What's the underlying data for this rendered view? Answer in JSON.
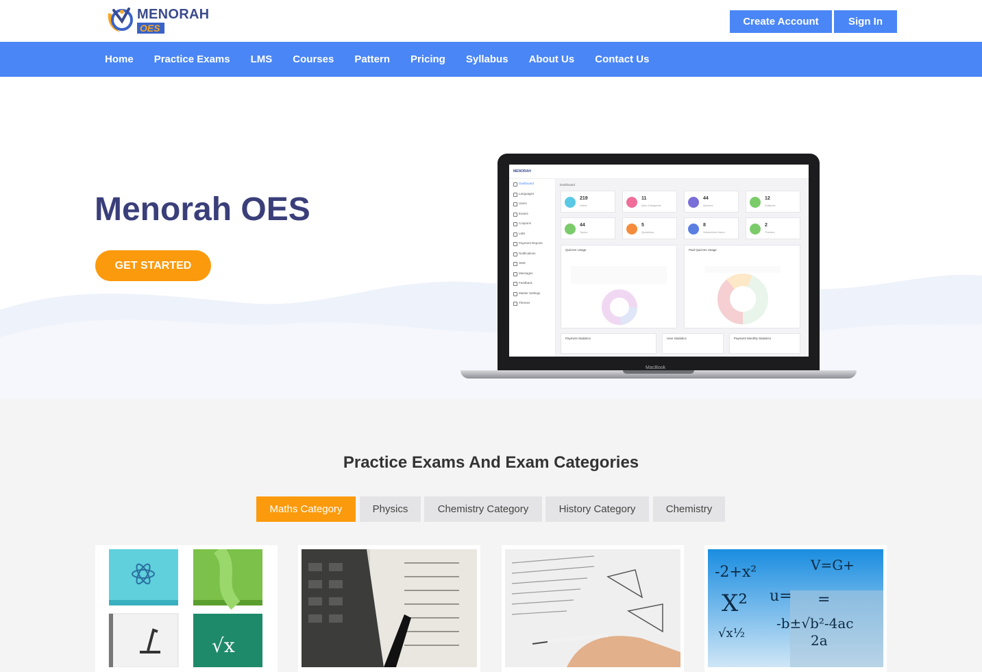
{
  "header": {
    "logo_name": "MENORAH",
    "logo_sub": "OES",
    "create_account": "Create Account",
    "sign_in": "Sign In"
  },
  "nav": {
    "items": [
      "Home",
      "Practice Exams",
      "LMS",
      "Courses",
      "Pattern",
      "Pricing",
      "Syllabus",
      "About Us",
      "Contact Us"
    ]
  },
  "hero": {
    "title": "Menorah OES",
    "cta": "GET STARTED"
  },
  "laptop_screen": {
    "brand": "MENORAH",
    "breadcrumb": "Dashboard",
    "sidebar": [
      "Dashboard",
      "Languages",
      "Users",
      "Exams",
      "Coupons",
      "LMS",
      "Payment Reports",
      "Notifications",
      "SMS",
      "Messages",
      "Feedback",
      "Master Settings",
      "Themes"
    ],
    "stats": [
      {
        "num": "219",
        "label": "Users",
        "color": "#5bc9e6"
      },
      {
        "num": "11",
        "label": "Quiz Categories",
        "color": "#f06e9a"
      },
      {
        "num": "44",
        "label": "Quizzes",
        "color": "#7a6fd8"
      },
      {
        "num": "12",
        "label": "Subjects",
        "color": "#7ccb6b"
      },
      {
        "num": "44",
        "label": "Topics",
        "color": "#7ccb6b"
      },
      {
        "num": "5",
        "label": "Questions",
        "color": "#f58b3c"
      },
      {
        "num": "8",
        "label": "Subscribed Users",
        "color": "#5b7fe0"
      },
      {
        "num": "2",
        "label": "Themes",
        "color": "#7ccb6b"
      }
    ],
    "panels": [
      "Quizzes Usage",
      "Paid Quizzes Usage",
      "Payment Statistics",
      "User Statistics",
      "Payment Monthly Statistics"
    ],
    "laptop_label": "MacBook"
  },
  "categories": {
    "title": "Practice Exams And Exam Categories",
    "tabs": [
      "Maths Category",
      "Physics",
      "Chemistry Category",
      "History Category",
      "Chemistry"
    ],
    "active_tab": "Maths Category"
  },
  "cards": [
    {
      "icon": "books-collage-image"
    },
    {
      "icon": "calculator-pen-image"
    },
    {
      "icon": "hand-writing-geometry-image"
    },
    {
      "icon": "math-formulas-image"
    }
  ],
  "colors": {
    "primary": "#4a86f5",
    "accent": "#fb9a0c",
    "title": "#3a3f7a"
  }
}
